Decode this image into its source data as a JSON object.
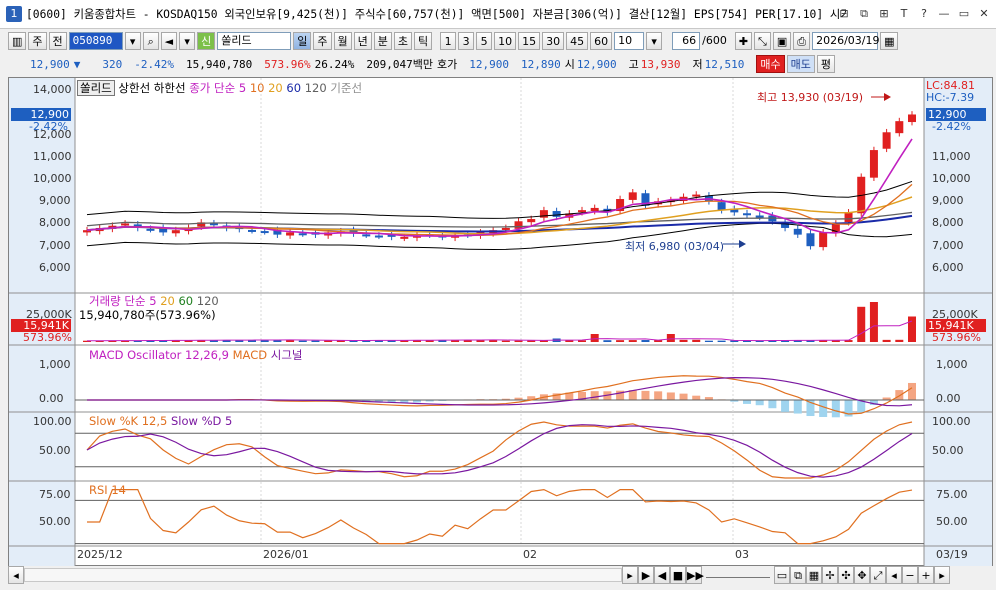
{
  "title": {
    "text": "[0600] 키움종합차트 - KOSDAQ150 외국인보유[9,425(천)] 주식수[60,757(천)] 액면[500] 자본금[306(억)] 결산[12월] EPS[754] PER[17.10] 시가총",
    "app_number": "1",
    "buttons": [
      "⊟",
      "⧉",
      "⊞",
      "T",
      "?",
      "—",
      "▭",
      "✕"
    ]
  },
  "toolbar": {
    "mode": "주",
    "prev": "전",
    "code": "050890",
    "tag": "신",
    "name": "쏠리드",
    "periods": [
      "일",
      "주",
      "월",
      "년",
      "분",
      "초",
      "틱"
    ],
    "active_period": "일",
    "intervals": [
      "1",
      "3",
      "5",
      "10",
      "15",
      "30",
      "45",
      "60"
    ],
    "interval_value": "10",
    "count": "66",
    "count_total": "/600",
    "date": "2026/03/19"
  },
  "quote": {
    "price": "12,900",
    "arrow": "▼",
    "change": "320",
    "change_pct": "-2.42%",
    "volume": "15,940,780",
    "vol_ratio": "573.96%",
    "turnover": "26.24%",
    "amount": "209,047백만",
    "bid_label": "호가",
    "ask": "12,900",
    "bid": "12,890",
    "open_label": "시",
    "open": "12,900",
    "high_label": "고",
    "high": "13,930",
    "low_label": "저",
    "low": "12,510",
    "buy": "매수",
    "sell": "매도",
    "eval": "평"
  },
  "chart": {
    "price_legend": {
      "name": "쏠리드",
      "bands": "상한선  하한선",
      "ma_label": "종가 단순 5",
      "ma_periods": [
        "10",
        "20",
        "60",
        "120"
      ],
      "base": "기준선"
    },
    "price_axis": [
      "14,000",
      "13,000",
      "12,000",
      "11,000",
      "10,000",
      "9,000",
      "8,000",
      "7,000",
      "6,000"
    ],
    "last_price_tag": "12,900",
    "last_pct_tag": "-2.42%",
    "lc_label": "LC:84.81",
    "hc_label": "HC:-7.39",
    "high_note": "최고 13,930 (03/19)",
    "low_note": "최저 6,980 (03/04)",
    "volume_legend": "거래량  단순 5",
    "volume_ma_periods": [
      "20",
      "60",
      "120"
    ],
    "volume_value": "15,940,780주(573.96%)",
    "volume_axis": "25,000K",
    "volume_tag": "15,941K",
    "volume_pct": "573.96%",
    "macd_legend": "MACD Oscillator 12,26,9",
    "macd_line": "MACD",
    "macd_signal": "시그널",
    "macd_axis": [
      "1,000",
      "0.00"
    ],
    "stoch_k": "Slow %K 12,5",
    "stoch_d": "Slow %D 5",
    "stoch_axis": [
      "100.00",
      "50.00"
    ],
    "rsi_legend": "RSI 14",
    "rsi_axis": [
      "75.00",
      "50.00"
    ],
    "date_labels": [
      "2025/12",
      "2026/01",
      "02",
      "03"
    ],
    "right_date": "03/19"
  },
  "colors": {
    "up": "#e02020",
    "down": "#1e5fc0",
    "ma5": "#c020c0",
    "ma10": "#e07020",
    "ma20": "#e0a020",
    "ma60": "#1a2aa8",
    "ma120": "#606060",
    "accent": "#1f57c3"
  }
}
